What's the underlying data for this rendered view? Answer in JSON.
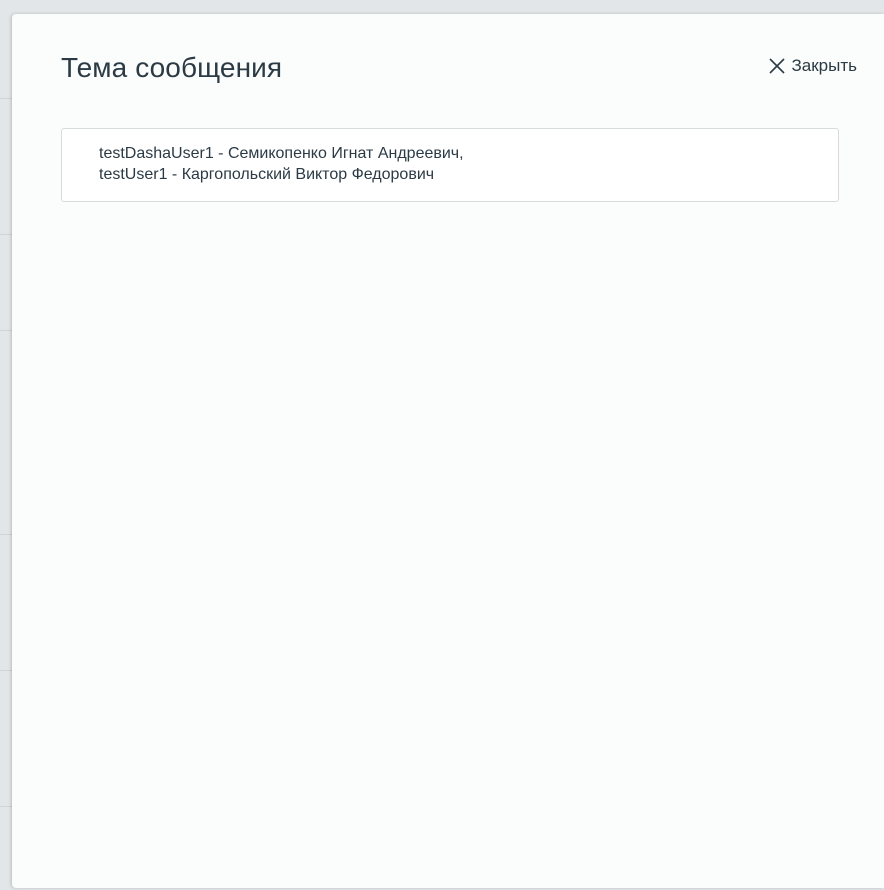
{
  "dialog": {
    "title": "Тема сообщения",
    "close_label": "Закрыть",
    "close_icon": "close-icon"
  },
  "recipients": [
    "testDashaUser1 - Семикопенко Игнат Андреевич,",
    "testUser1 - Каргопольский Виктор Федорович"
  ],
  "colors": {
    "text": "#2b3a44",
    "modal_bg": "#fbfcfc",
    "border": "#d7dcdf"
  }
}
